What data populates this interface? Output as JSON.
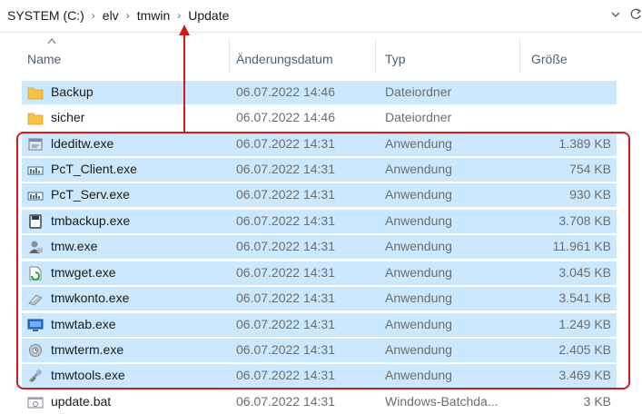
{
  "address_bar": {
    "crumbs": [
      "SYSTEM (C:)",
      "elv",
      "tmwin",
      "Update"
    ],
    "separator_glyph": "›",
    "dropdown_icon": "chevron-down-icon",
    "refresh_icon": "refresh-icon"
  },
  "columns": {
    "name": "Name",
    "date": "Änderungsdatum",
    "type": "Typ",
    "size": "Größe"
  },
  "files": [
    {
      "name": "Backup",
      "date": "06.07.2022 14:46",
      "type": "Dateiordner",
      "size": "",
      "icon": "folder-icon",
      "selected": true
    },
    {
      "name": "sicher",
      "date": "06.07.2022 14:46",
      "type": "Dateiordner",
      "size": "",
      "icon": "folder-icon",
      "selected": false
    },
    {
      "name": "ldeditw.exe",
      "date": "06.07.2022 14:31",
      "type": "Anwendung",
      "size": "1.389 KB",
      "icon": "application-window-icon",
      "selected": true
    },
    {
      "name": "PcT_Client.exe",
      "date": "06.07.2022 14:31",
      "type": "Anwendung",
      "size": "754 KB",
      "icon": "network-app-icon",
      "selected": true
    },
    {
      "name": "PcT_Serv.exe",
      "date": "06.07.2022 14:31",
      "type": "Anwendung",
      "size": "930 KB",
      "icon": "network-app-icon",
      "selected": true
    },
    {
      "name": "tmbackup.exe",
      "date": "06.07.2022 14:31",
      "type": "Anwendung",
      "size": "3.708 KB",
      "icon": "backup-disk-icon",
      "selected": true
    },
    {
      "name": "tmw.exe",
      "date": "06.07.2022 14:31",
      "type": "Anwendung",
      "size": "11.961 KB",
      "icon": "user-app-icon",
      "selected": true
    },
    {
      "name": "tmwget.exe",
      "date": "06.07.2022 14:31",
      "type": "Anwendung",
      "size": "3.045 KB",
      "icon": "download-app-icon",
      "selected": true
    },
    {
      "name": "tmwkonto.exe",
      "date": "06.07.2022 14:31",
      "type": "Anwendung",
      "size": "3.541 KB",
      "icon": "account-app-icon",
      "selected": true
    },
    {
      "name": "tmwtab.exe",
      "date": "06.07.2022 14:31",
      "type": "Anwendung",
      "size": "1.249 KB",
      "icon": "monitor-app-icon",
      "selected": true
    },
    {
      "name": "tmwterm.exe",
      "date": "06.07.2022 14:31",
      "type": "Anwendung",
      "size": "2.405 KB",
      "icon": "terminal-app-icon",
      "selected": true
    },
    {
      "name": "tmwtools.exe",
      "date": "06.07.2022 14:31",
      "type": "Anwendung",
      "size": "3.469 KB",
      "icon": "tools-app-icon",
      "selected": true
    },
    {
      "name": "update.bat",
      "date": "06.07.2022 14:31",
      "type": "Windows-Batchda...",
      "size": "3 KB",
      "icon": "batch-file-icon",
      "selected": false
    }
  ],
  "colors": {
    "selection": "#cce8ff",
    "annotation": "#d11a1a",
    "folder": "#f5c242"
  }
}
